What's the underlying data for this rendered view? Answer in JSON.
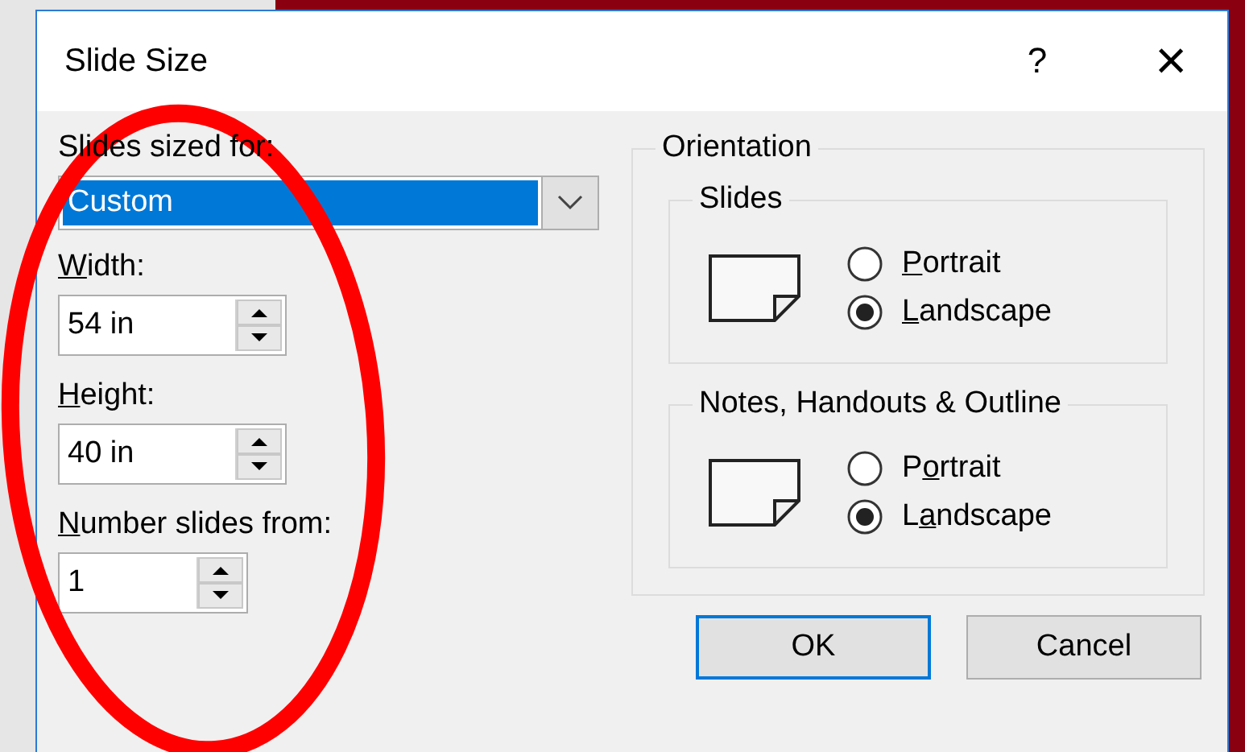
{
  "window": {
    "title": "Slide Size",
    "help": "?",
    "close": "×"
  },
  "sized_for": {
    "label": "Slides sized for:",
    "value": "Custom"
  },
  "fields": [
    {
      "label": {
        "key": "W",
        "rest": "idth:"
      },
      "value": "54 in",
      "kind": "wide"
    },
    {
      "label": {
        "key": "H",
        "rest": "eight:"
      },
      "value": "40 in",
      "kind": "wide"
    },
    {
      "label": {
        "key": "N",
        "rest": "umber slides from:"
      },
      "value": "1",
      "kind": "narrow"
    }
  ],
  "orientation": {
    "title": "Orientation",
    "groups": [
      {
        "title": "Slides",
        "options": [
          {
            "label": {
              "key": "P",
              "rest": "ortrait"
            },
            "selected": false
          },
          {
            "label": {
              "key": "L",
              "rest": "andscape"
            },
            "selected": true
          }
        ]
      },
      {
        "title": "Notes, Handouts & Outline",
        "options": [
          {
            "label": {
              "lead": "P",
              "key": "o",
              "rest": "rtrait"
            },
            "selected": false
          },
          {
            "label": {
              "lead": "L",
              "key": "a",
              "rest": "ndscape"
            },
            "selected": true
          }
        ]
      }
    ]
  },
  "buttons": [
    {
      "label": "OK",
      "kind": "default"
    },
    {
      "label": "Cancel",
      "kind": "normal"
    }
  ],
  "annotation": {
    "kind": "ellipse"
  }
}
